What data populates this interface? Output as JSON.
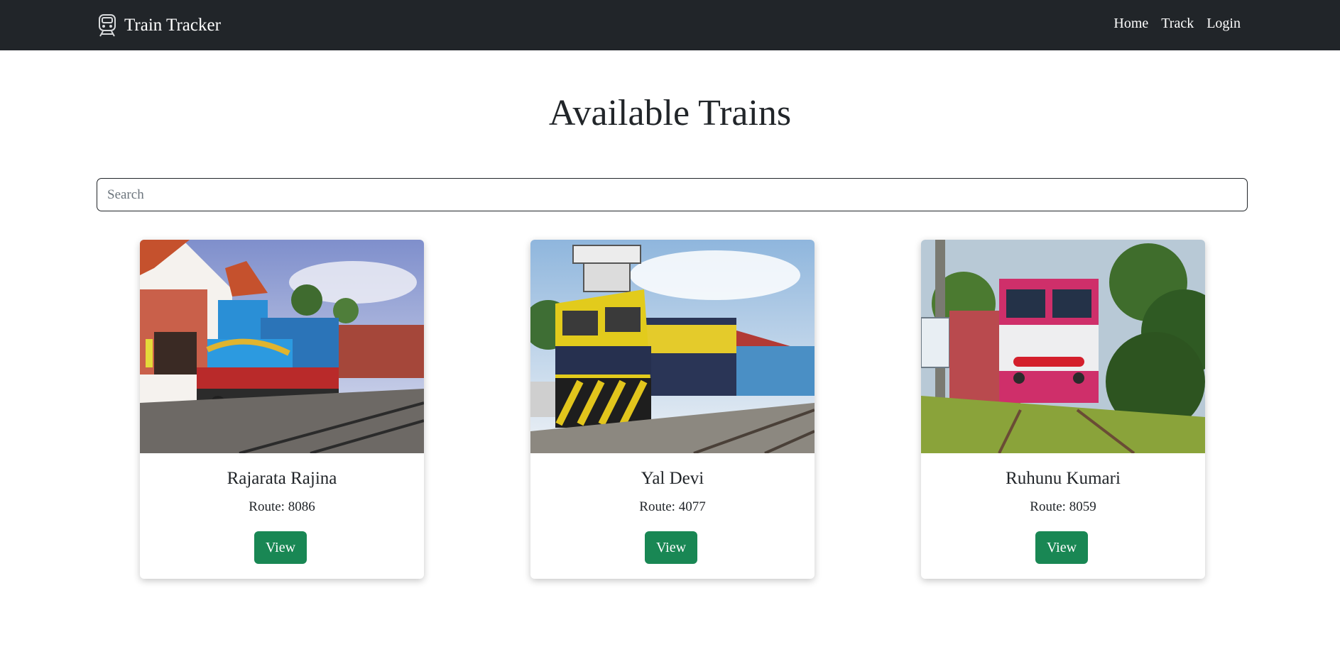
{
  "navbar": {
    "brand_text": "Train Tracker",
    "brand_icon": "train-icon",
    "links": [
      {
        "label": "Home"
      },
      {
        "label": "Track"
      },
      {
        "label": "Login"
      }
    ]
  },
  "main": {
    "title": "Available Trains",
    "search": {
      "placeholder": "Search",
      "value": ""
    },
    "trains": [
      {
        "name": "Rajarata Rajina",
        "route": "Route: 8086",
        "button_label": "View",
        "image": "blue-diesel-locomotive-at-station-photo"
      },
      {
        "name": "Yal Devi",
        "route": "Route: 4077",
        "button_label": "View",
        "image": "yellow-diesel-locomotive-photo"
      },
      {
        "name": "Ruhunu Kumari",
        "route": "Route: 8059",
        "button_label": "View",
        "image": "red-white-dmu-train-photo"
      }
    ]
  },
  "colors": {
    "navbar_bg": "#212529",
    "button_bg": "#198754",
    "text": "#212529"
  }
}
